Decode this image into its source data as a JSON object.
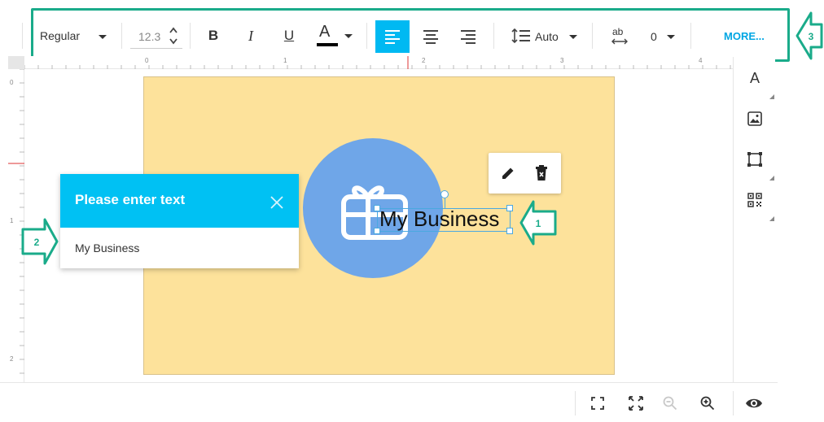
{
  "toolbar": {
    "font_weight": "Regular",
    "font_size": "12.3",
    "bold_label": "B",
    "italic_label": "I",
    "underline_label": "U",
    "text_color_label": "A",
    "text_color": "#000000",
    "line_height": "Auto",
    "letter_spacing_icon_label": "ab",
    "letter_spacing": "0",
    "more_label": "MORE...",
    "active_color": "#00b9f2"
  },
  "rulers": {
    "top": [
      "0",
      "1",
      "2",
      "3",
      "4"
    ],
    "left": [
      "0",
      "1",
      "2"
    ]
  },
  "canvas": {
    "card_color": "#fde29b",
    "circle_color": "#6fa6e8",
    "text": "My Business"
  },
  "dialog": {
    "title": "Please enter text",
    "value": "My Business",
    "header_color": "#00c1f3"
  },
  "side_panel": {
    "text_tool_label": "A"
  },
  "callouts": {
    "one": "1",
    "two": "2",
    "three": "3",
    "color": "#1aab8a"
  },
  "icons": [
    "chevron-up-icon",
    "chevron-down-icon",
    "align-left-icon",
    "align-center-icon",
    "align-right-icon",
    "line-height-icon",
    "letter-spacing-icon",
    "pencil-icon",
    "trash-icon",
    "close-icon",
    "image-icon",
    "shape-icon",
    "qr-code-icon",
    "fit-screen-icon",
    "fullscreen-icon",
    "zoom-out-icon",
    "zoom-in-icon",
    "eye-icon",
    "gift-card-icon"
  ]
}
